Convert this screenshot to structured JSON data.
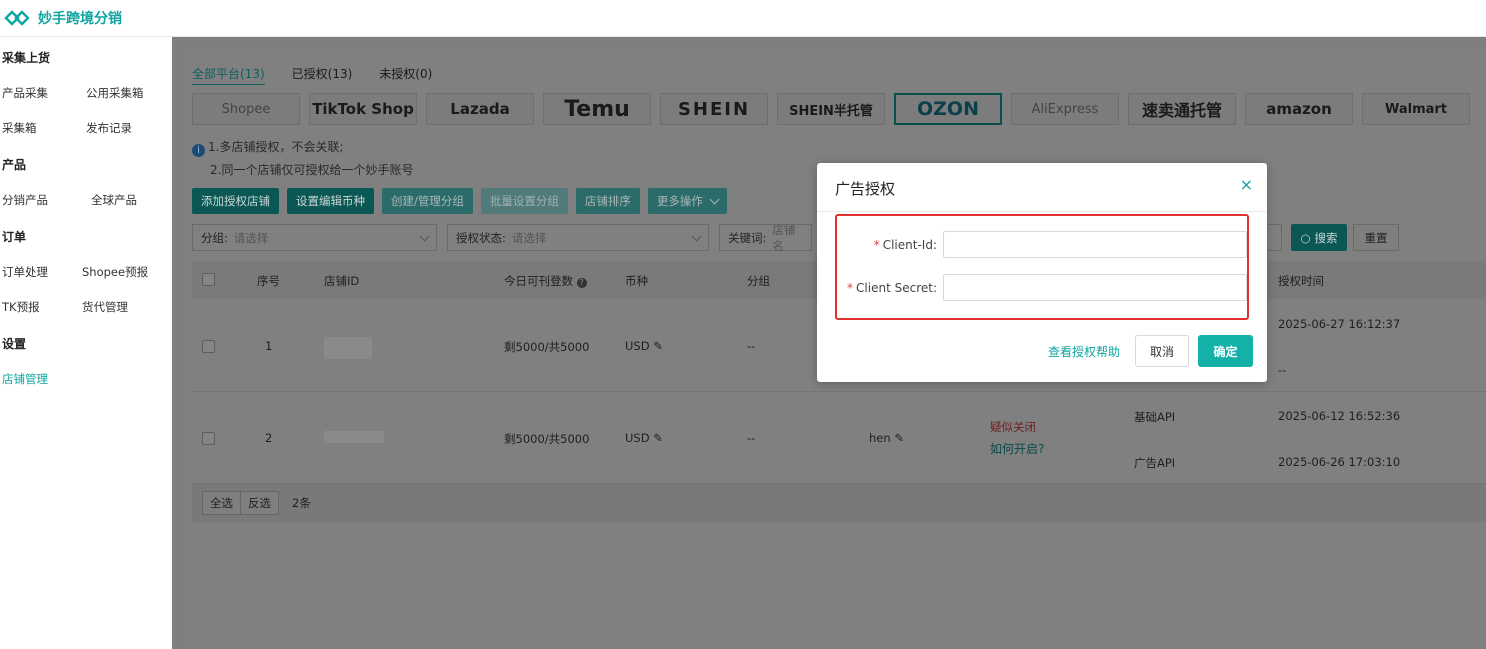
{
  "brand": {
    "name": "妙手跨境分销"
  },
  "sidebar": {
    "groups": [
      {
        "title": "采集上货",
        "items": [
          "产品采集",
          "公用采集箱",
          "采集箱",
          "发布记录"
        ]
      },
      {
        "title": "产品",
        "items": [
          "分销产品",
          "全球产品"
        ]
      },
      {
        "title": "订单",
        "items": [
          "订单处理",
          "Shopee预报",
          "TK预报",
          "货代管理"
        ]
      },
      {
        "title": "设置",
        "items": [
          "店铺管理"
        ]
      }
    ],
    "active_item": "店铺管理"
  },
  "platform_tabs": [
    "全部平台(13)",
    "已授权(13)",
    "未授权(0)"
  ],
  "platforms": [
    "Shopee",
    "TikTok Shop",
    "Lazada",
    "Temu",
    "SHEIN",
    "SHEIN半托管",
    "OZON",
    "AliExpress",
    "速卖通托管",
    "amazon",
    "Walmart"
  ],
  "notes": [
    "1.多店铺授权，不会关联;",
    "2.同一个店铺仅可授权给一个妙手账号"
  ],
  "toolbar": [
    "添加授权店铺",
    "设置编辑币种",
    "创建/管理分组",
    "批量设置分组",
    "店铺排序",
    "更多操作"
  ],
  "filters": {
    "group_label": "分组:",
    "group_placeholder": "请选择",
    "auth_label": "授权状态:",
    "auth_placeholder": "请选择",
    "keyword_label": "关键词:",
    "keyword_placeholder": "店铺名",
    "search_label": "搜索",
    "reset_label": "重置"
  },
  "table": {
    "headers": [
      "序号",
      "店铺ID",
      "今日可刊登数",
      "币种",
      "分组",
      "授权时间"
    ],
    "rows": [
      {
        "index": "1",
        "quota": "剩5000/共5000",
        "currency": "USD",
        "group": "--",
        "auth_times": [
          "2025-06-27 16:12:37",
          "--"
        ]
      },
      {
        "index": "2",
        "quota": "剩5000/共5000",
        "currency": "USD",
        "group": "--",
        "owner": "hen",
        "status": "疑似关闭",
        "status_link": "如何开启?",
        "apis": [
          "基础API",
          "广告API"
        ],
        "auth_times": [
          "2025-06-12 16:52:36",
          "2025-06-26 17:03:10"
        ]
      }
    ]
  },
  "footer": {
    "select_all": "全选",
    "invert": "反选",
    "count": "2条"
  },
  "modal": {
    "title": "广告授权",
    "fields": [
      {
        "label": "Client-Id:",
        "value": ""
      },
      {
        "label": "Client Secret:",
        "value": ""
      }
    ],
    "required_mark": "*",
    "help_link": "查看授权帮助",
    "cancel_label": "取消",
    "ok_label": "确定",
    "close_symbol": "×"
  },
  "colors": {
    "brand": "#0ea5a0",
    "primary": "#14b1a8",
    "danger": "#e03030"
  }
}
